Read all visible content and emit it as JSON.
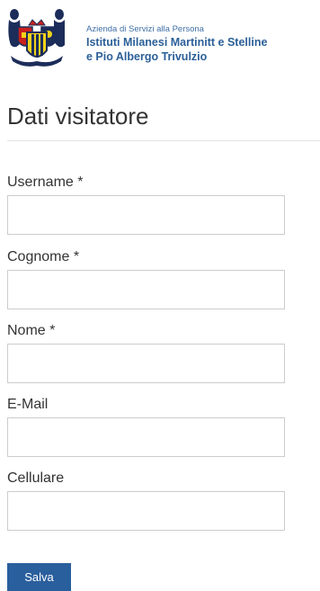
{
  "header": {
    "subtitle": "Azienda di Servizi alla Persona",
    "name_line1": "Istituti Milanesi Martinitt e Stelline",
    "name_line2": "e Pio Albergo Trivulzio",
    "logo_icon": "coat-of-arms-icon"
  },
  "page": {
    "title": "Dati visitatore"
  },
  "form": {
    "fields": [
      {
        "label": "Username *",
        "value": ""
      },
      {
        "label": "Cognome *",
        "value": ""
      },
      {
        "label": "Nome *",
        "value": ""
      },
      {
        "label": "E-Mail",
        "value": ""
      },
      {
        "label": "Cellulare",
        "value": ""
      }
    ],
    "submit_label": "Salva"
  },
  "colors": {
    "brand_blue": "#2a5f9d",
    "logo_red": "#c8201e",
    "logo_navy": "#1c2d5a",
    "logo_yellow": "#f2d21b"
  }
}
